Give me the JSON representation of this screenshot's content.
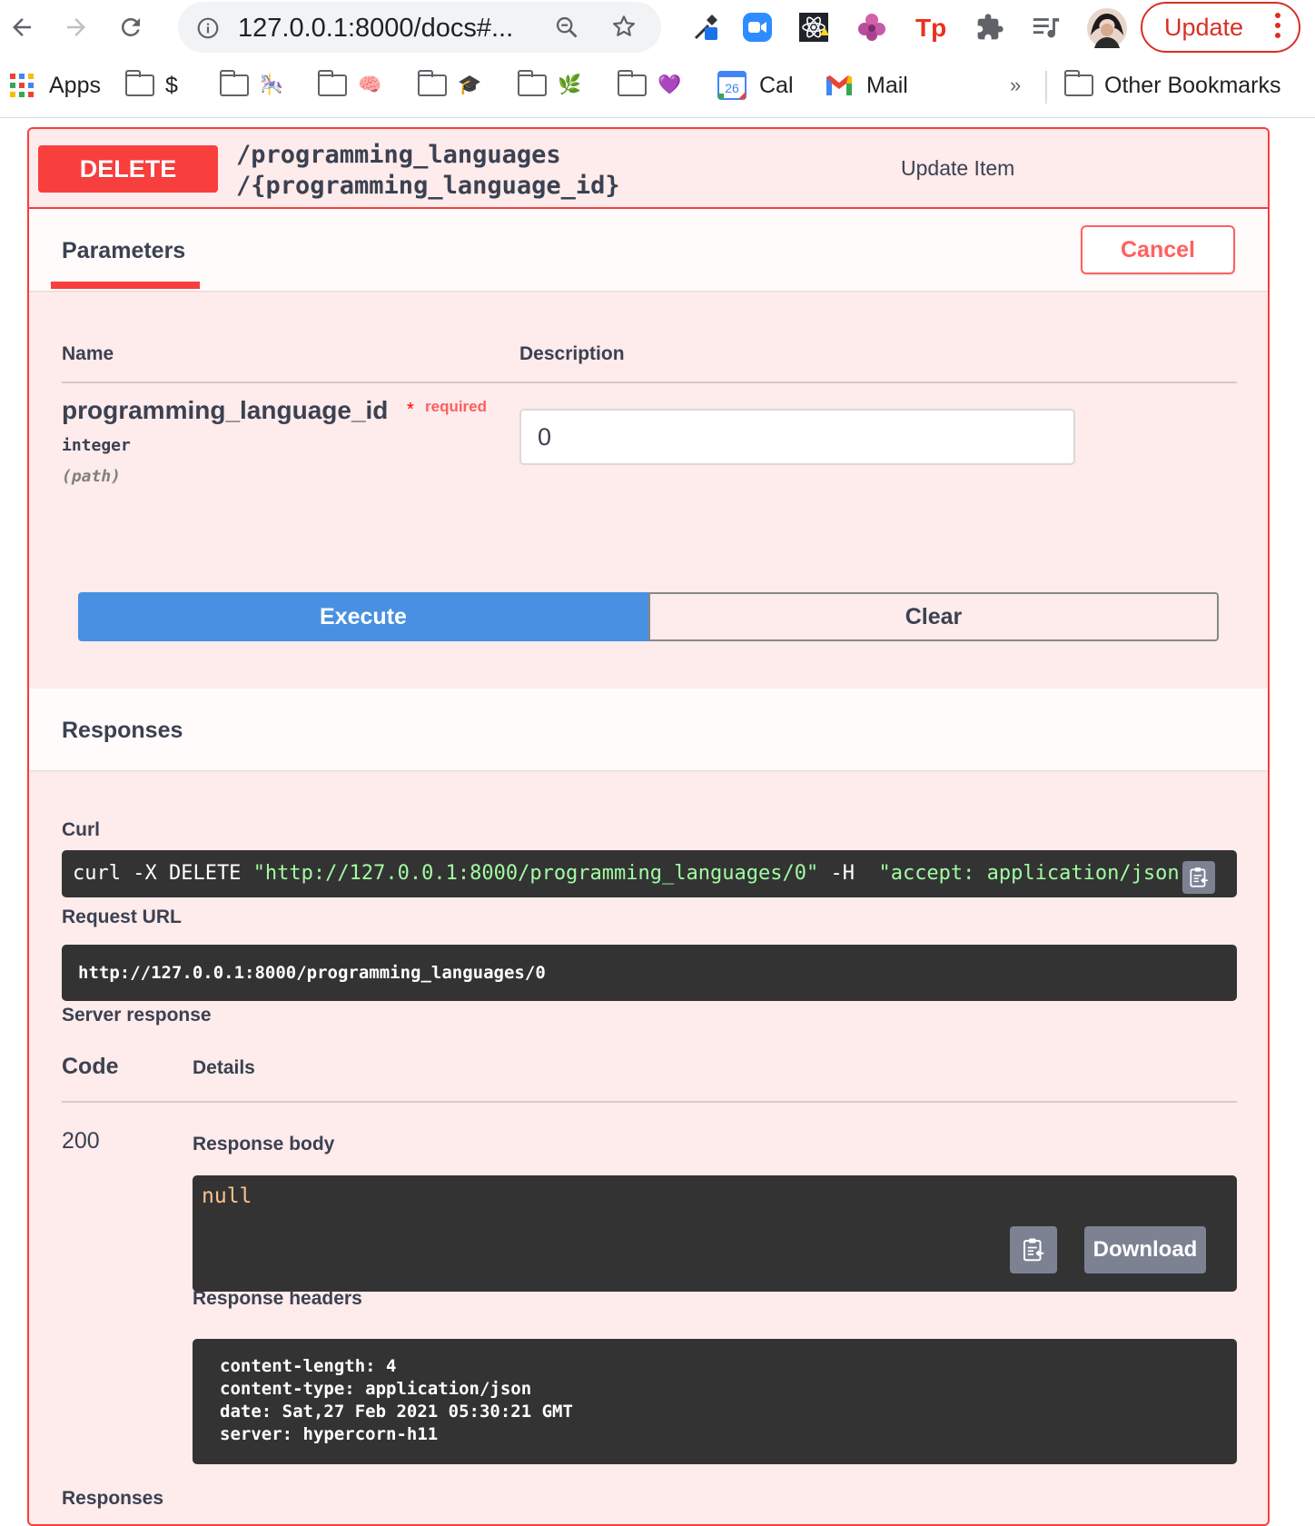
{
  "browser": {
    "url": "127.0.0.1:8000/docs#...",
    "update_label": "Update",
    "icons": [
      "back-icon",
      "forward-icon",
      "reload-icon",
      "info-icon",
      "zoom-icon",
      "star-icon",
      "eyedropper-icon",
      "zoom-meetings-icon",
      "react-devtools-icon",
      "extension-flower-icon",
      "tp-extension-icon",
      "puzzle-icon",
      "media-queue-icon",
      "profile-avatar"
    ],
    "accent_color": "#d93025"
  },
  "bookmarks": {
    "apps": "Apps",
    "items": [
      {
        "label": "$",
        "icon": "folder-icon"
      },
      {
        "label": "🎠",
        "icon": "folder-icon"
      },
      {
        "label": "🧠",
        "icon": "folder-icon"
      },
      {
        "label": "🎓",
        "icon": "folder-icon"
      },
      {
        "label": "🌿",
        "icon": "folder-icon"
      },
      {
        "label": "💜",
        "icon": "folder-icon"
      }
    ],
    "cal": "Cal",
    "cal_day": "26",
    "mail": "Mail",
    "overflow": "»",
    "other": "Other Bookmarks"
  },
  "operation": {
    "method": "DELETE",
    "path_line1": "/programming_languages",
    "path_line2": "/{programming_language_id}",
    "summary": "Update Item",
    "method_color": "#f93e3e"
  },
  "parameters": {
    "tab": "Parameters",
    "cancel": "Cancel",
    "col_name": "Name",
    "col_description": "Description",
    "param": {
      "name": "programming_language_id",
      "required_star": "*",
      "required": "required",
      "type": "integer",
      "in": "(path)",
      "value": "0"
    },
    "execute": "Execute",
    "clear": "Clear"
  },
  "responses": {
    "title": "Responses",
    "curl_label": "Curl",
    "curl_cmd": "curl -X DELETE ",
    "curl_url": "\"http://127.0.0.1:8000/programming_languages/0\"",
    "curl_flag": " -H  ",
    "curl_header": "\"accept: application/json\"",
    "request_url_label": "Request URL",
    "request_url": "http://127.0.0.1:8000/programming_languages/0",
    "server_response_label": "Server response",
    "code_label": "Code",
    "details_label": "Details",
    "code": "200",
    "body_label": "Response body",
    "body": "null",
    "download": "Download",
    "headers_label": "Response headers",
    "headers": [
      "content-length: 4",
      "content-type: application/json",
      "date: Sat,27 Feb 2021 05:30:21 GMT",
      "server: hypercorn-h11"
    ],
    "footer_label": "Responses"
  }
}
